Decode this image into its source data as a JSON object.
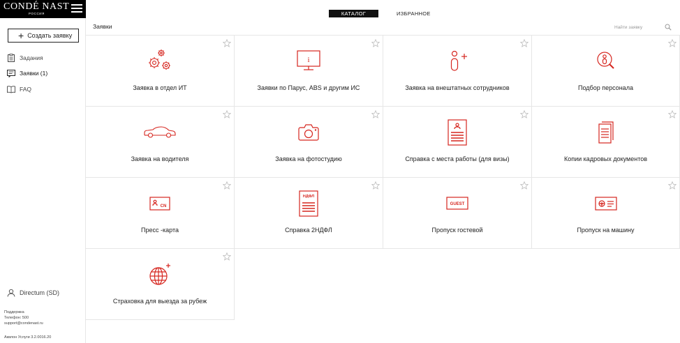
{
  "logo": {
    "text": "CONDÉ NAST",
    "sub": "РОССИЯ"
  },
  "sidebar": {
    "create_label": "Создать заявку",
    "items": [
      {
        "label": "Задания",
        "icon": "clipboard-icon"
      },
      {
        "label": "Заявки (1)",
        "icon": "chat-icon"
      },
      {
        "label": "FAQ",
        "icon": "book-icon"
      }
    ],
    "user": "Directum (SD)",
    "support": {
      "line1": "Поддержка",
      "line2": "Телефон: 500",
      "line3": "support@condenast.ru"
    },
    "version": "Аквлон Услуги 3.2.0016.20"
  },
  "header": {
    "tabs": [
      {
        "label": "КАТАЛОГ"
      },
      {
        "label": "ИЗБРАННОЕ"
      }
    ],
    "breadcrumb": "Заявки",
    "search_placeholder": "Найти заявку"
  },
  "colors": {
    "accent": "#d6261f",
    "dark": "#111111",
    "border": "#e6e6e6"
  },
  "cards": [
    {
      "title": "Заявка в отдел ИТ",
      "icon": "gears-icon"
    },
    {
      "title": "Заявки по Парус, ABS и другим ИС",
      "icon": "monitor-info-icon"
    },
    {
      "title": "Заявка на внештатных сотрудников",
      "icon": "add-person-icon"
    },
    {
      "title": "Подбор персонала",
      "icon": "magnifier-person-icon"
    },
    {
      "title": "Заявка на водителя",
      "icon": "car-icon"
    },
    {
      "title": "Заявка на фотостудию",
      "icon": "camera-icon"
    },
    {
      "title": "Справка с места работы (для визы)",
      "icon": "certificate-icon"
    },
    {
      "title": "Копии кадровых документов",
      "icon": "documents-icon"
    },
    {
      "title": "Пресс -карта",
      "icon": "press-card-icon"
    },
    {
      "title": "Справка 2НДФЛ",
      "icon": "tax-form-icon"
    },
    {
      "title": "Пропуск гостевой",
      "icon": "guest-pass-icon"
    },
    {
      "title": "Пропуск на машину",
      "icon": "car-pass-icon"
    },
    {
      "title": "Страховка для выезда за рубеж",
      "icon": "globe-plus-icon"
    }
  ],
  "card_icon_labels": {
    "press": "CN",
    "tax": "НДФЛ",
    "guest": "GUEST"
  }
}
